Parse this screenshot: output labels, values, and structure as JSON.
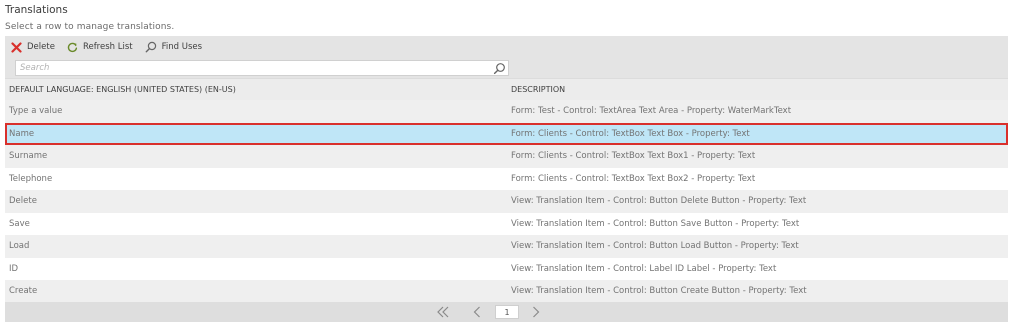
{
  "page": {
    "title": "Translations",
    "subtitle": "Select a row to manage translations."
  },
  "toolbar": {
    "delete_label": "Delete",
    "refresh_label": "Refresh List",
    "find_uses_label": "Find Uses"
  },
  "search": {
    "placeholder": "Search",
    "value": ""
  },
  "table": {
    "columns": [
      "DEFAULT LANGUAGE: ENGLISH (UNITED STATES) (EN-US)",
      "DESCRIPTION"
    ],
    "rows": [
      {
        "value": "Type a value",
        "description": "Form: Test - Control: TextArea Text Area - Property: WaterMarkText"
      },
      {
        "value": "Name",
        "description": "Form: Clients - Control: TextBox Text Box - Property: Text",
        "selected": true
      },
      {
        "value": "Surname",
        "description": "Form: Clients - Control: TextBox Text Box1 - Property: Text"
      },
      {
        "value": "Telephone",
        "description": "Form: Clients - Control: TextBox Text Box2 - Property: Text"
      },
      {
        "value": "Delete",
        "description": "View: Translation Item - Control: Button Delete Button - Property: Text"
      },
      {
        "value": "Save",
        "description": "View: Translation Item - Control: Button Save Button - Property: Text"
      },
      {
        "value": "Load",
        "description": "View: Translation Item - Control: Button Load Button - Property: Text"
      },
      {
        "value": "ID",
        "description": "View: Translation Item - Control: Label ID Label - Property: Text"
      },
      {
        "value": "Create",
        "description": "View: Translation Item - Control: Button Create Button - Property: Text"
      }
    ]
  },
  "pager": {
    "current_page": "1"
  },
  "colors": {
    "selected_row": "#bfe6f7",
    "selected_border": "#d9302c",
    "delete_icon": "#d9302c",
    "refresh_icon": "#6a8a2a"
  },
  "icons": [
    "delete-x-icon",
    "refresh-icon",
    "find-uses-search-icon",
    "search-icon",
    "first-page-icon",
    "prev-page-icon",
    "next-page-icon"
  ]
}
